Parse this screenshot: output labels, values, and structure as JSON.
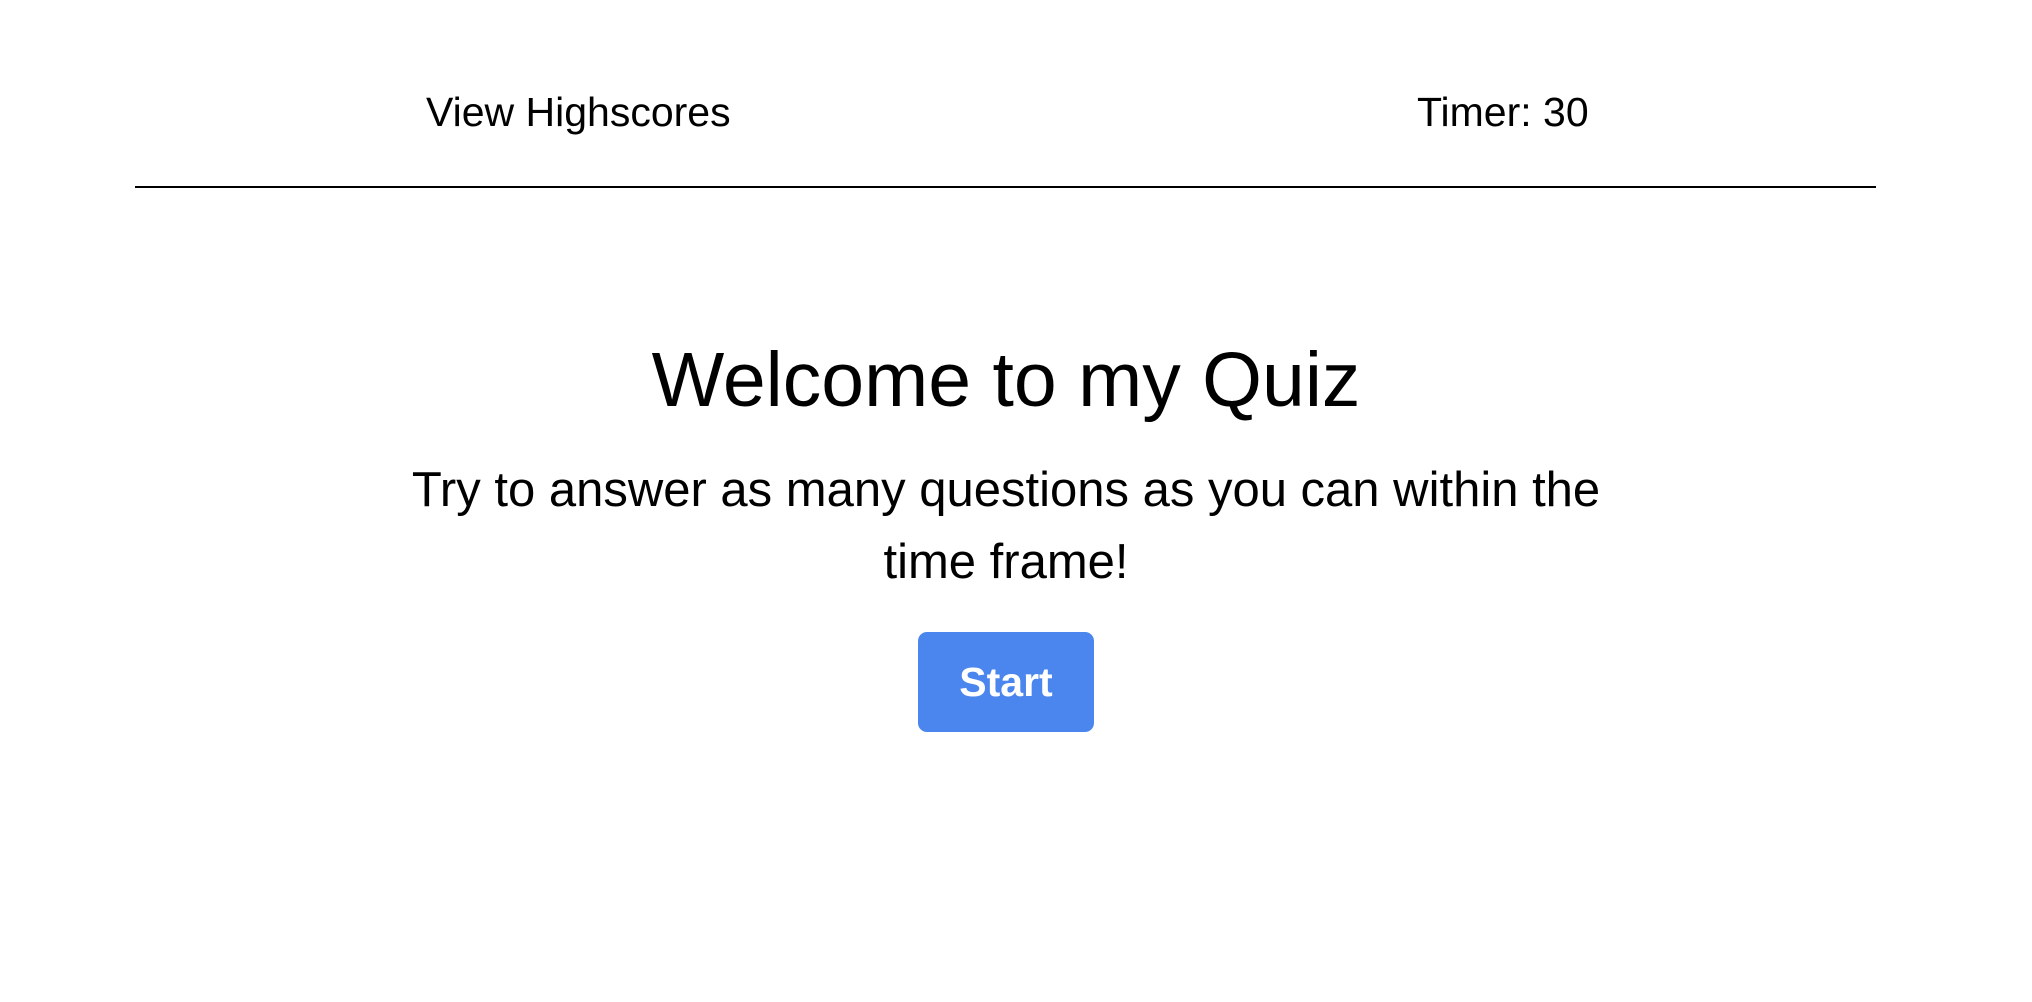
{
  "header": {
    "highscores_label": "View Highscores",
    "timer_text": "Timer: 30"
  },
  "main": {
    "title": "Welcome to my Quiz",
    "subtitle": "Try to answer as many questions as you can within the time frame!",
    "start_label": "Start"
  },
  "colors": {
    "accent": "#4b86ef",
    "text": "#000000",
    "background": "#ffffff"
  }
}
